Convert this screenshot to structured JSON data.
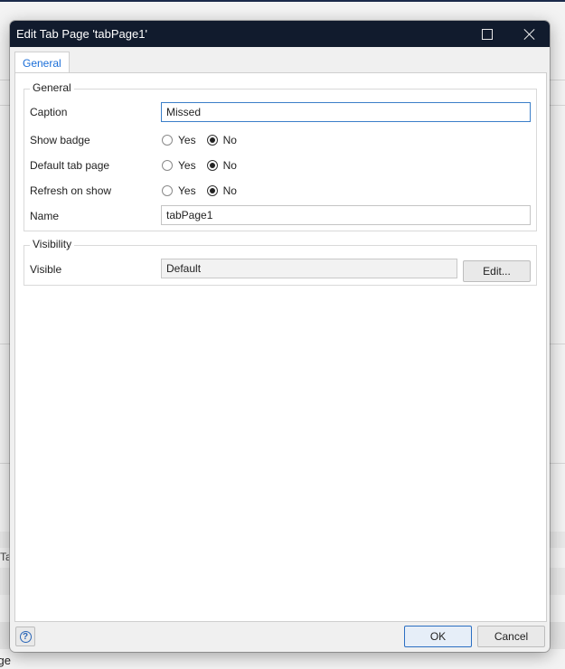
{
  "dialog": {
    "title": "Edit Tab Page 'tabPage1'",
    "tabs": [
      {
        "label": "General",
        "active": true
      }
    ],
    "general_group": {
      "legend": "General",
      "caption": {
        "label": "Caption",
        "value": "Missed"
      },
      "show_badge": {
        "label": "Show badge",
        "options": [
          "Yes",
          "No"
        ],
        "selected": "No"
      },
      "default_tab_page": {
        "label": "Default tab page",
        "options": [
          "Yes",
          "No"
        ],
        "selected": "No"
      },
      "refresh_on_show": {
        "label": "Refresh on show",
        "options": [
          "Yes",
          "No"
        ],
        "selected": "No"
      },
      "name": {
        "label": "Name",
        "value": "tabPage1"
      }
    },
    "visibility_group": {
      "legend": "Visibility",
      "visible": {
        "label": "Visible",
        "value": "Default",
        "edit_label": "Edit..."
      }
    },
    "footer": {
      "help_glyph": "?",
      "ok_label": "OK",
      "cancel_label": "Cancel"
    }
  },
  "background": {
    "tab_fragment": "Ta",
    "bottom_text": "ge"
  },
  "colors": {
    "titlebar": "#111b2d",
    "accent": "#1a6ed8",
    "focus_border": "#3b7fc9"
  }
}
